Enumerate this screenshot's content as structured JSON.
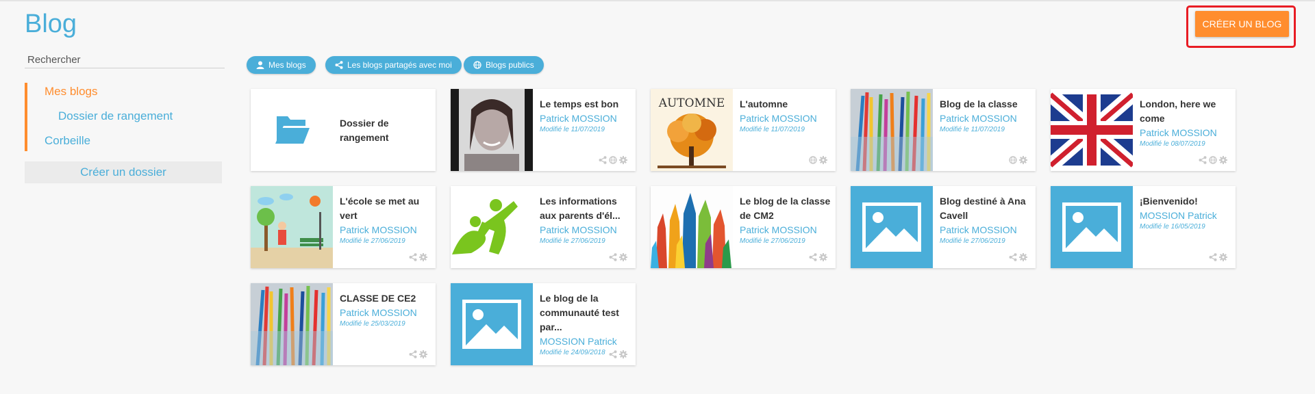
{
  "page": {
    "title": "Blog",
    "create_button": "CRÉER UN BLOG"
  },
  "sidebar": {
    "search_placeholder": "Rechercher",
    "tree": [
      {
        "label": "Mes blogs",
        "active": true
      },
      {
        "label": "Dossier de rangement",
        "active": false
      },
      {
        "label": "Corbeille",
        "active": false
      }
    ],
    "create_folder": "Créer un dossier"
  },
  "filters": [
    {
      "label": "Mes blogs",
      "icon": "user-icon"
    },
    {
      "label": "Les blogs partagés avec moi",
      "icon": "share-icon"
    },
    {
      "label": "Blogs publics",
      "icon": "globe-icon"
    }
  ],
  "folder_card": {
    "title": "Dossier de rangement",
    "icon": "folder-open-icon"
  },
  "blogs": [
    {
      "title": "Le temps est bon",
      "author": "Patrick MOSSION",
      "modified": "Modifié le 11/07/2019",
      "thumbnail": "portrait-photo",
      "actions": [
        "share-icon",
        "globe-icon",
        "gear-icon"
      ]
    },
    {
      "title": "L'automne",
      "author": "Patrick MOSSION",
      "modified": "Modifié le 11/07/2019",
      "thumbnail": "autumn-tree",
      "thumbnail_text": "AUTOMNE",
      "actions": [
        "globe-icon",
        "gear-icon"
      ]
    },
    {
      "title": "Blog de la classe",
      "author": "Patrick MOSSION",
      "modified": "Modifié le 11/07/2019",
      "thumbnail": "colored-pencils",
      "actions": [
        "globe-icon",
        "gear-icon"
      ]
    },
    {
      "title": "London, here we come",
      "author": "Patrick MOSSION",
      "modified": "Modifié le 08/07/2019",
      "thumbnail": "union-jack-flag",
      "actions": [
        "share-icon",
        "globe-icon",
        "gear-icon"
      ]
    },
    {
      "title": "L'école se met au vert",
      "author": "Patrick MOSSION",
      "modified": "Modifié le 27/06/2019",
      "thumbnail": "park-drawing",
      "actions": [
        "share-icon",
        "gear-icon"
      ]
    },
    {
      "title": "Les informations aux parents d'él...",
      "author": "Patrick MOSSION",
      "modified": "Modifié le 27/06/2019",
      "thumbnail": "green-figures",
      "actions": [
        "share-icon",
        "gear-icon"
      ]
    },
    {
      "title": "Le blog de la classe de CM2",
      "author": "Patrick MOSSION",
      "modified": "Modifié le 27/06/2019",
      "thumbnail": "raised-hands",
      "actions": [
        "share-icon",
        "gear-icon"
      ]
    },
    {
      "title": "Blog destiné à Ana Cavell",
      "author": "Patrick MOSSION",
      "modified": "Modifié le 27/06/2019",
      "thumbnail": "image-placeholder",
      "actions": [
        "share-icon",
        "gear-icon"
      ]
    },
    {
      "title": "¡Bienvenido!",
      "author": "MOSSION Patrick",
      "modified": "Modifié le 16/05/2019",
      "thumbnail": "image-placeholder",
      "actions": [
        "share-icon",
        "gear-icon"
      ]
    },
    {
      "title": "CLASSE DE CE2",
      "author": "Patrick MOSSION",
      "modified": "Modifié le 25/03/2019",
      "thumbnail": "colored-pencils",
      "actions": [
        "share-icon",
        "gear-icon"
      ]
    },
    {
      "title": "Le blog de la communauté test par...",
      "author": "MOSSION Patrick",
      "modified": "Modifié le 24/09/2018",
      "thumbnail": "image-placeholder",
      "actions": [
        "share-icon",
        "gear-icon"
      ]
    }
  ],
  "colors": {
    "accent_blue": "#4aaed9",
    "accent_orange": "#ff8d2e",
    "highlight_red": "#e81c24"
  }
}
